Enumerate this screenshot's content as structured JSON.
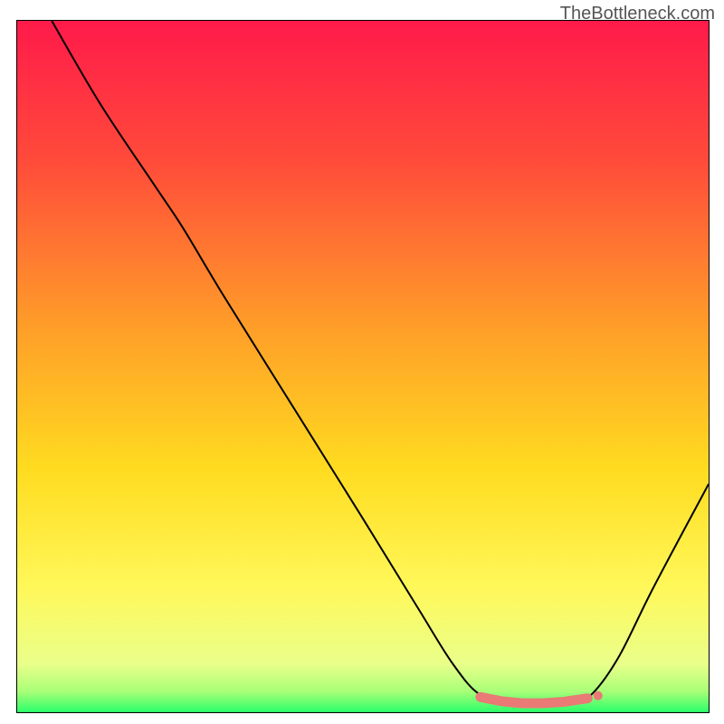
{
  "watermark": "TheBottleneck.com",
  "chart_data": {
    "type": "line",
    "title": "",
    "xlabel": "",
    "ylabel": "",
    "xlim": [
      0,
      100
    ],
    "ylim": [
      0,
      100
    ],
    "gradient_stops": [
      {
        "offset": 0,
        "color": "#ff1a4a"
      },
      {
        "offset": 20,
        "color": "#ff4a3a"
      },
      {
        "offset": 45,
        "color": "#ffa028"
      },
      {
        "offset": 65,
        "color": "#ffdc20"
      },
      {
        "offset": 82,
        "color": "#fff85a"
      },
      {
        "offset": 93,
        "color": "#eaff8a"
      },
      {
        "offset": 97,
        "color": "#a8ff78"
      },
      {
        "offset": 100,
        "color": "#2aff6a"
      }
    ],
    "series": [
      {
        "name": "bottleneck-curve",
        "color": "#000000",
        "points": [
          {
            "x": 5,
            "y": 100
          },
          {
            "x": 12,
            "y": 88
          },
          {
            "x": 20,
            "y": 76
          },
          {
            "x": 24,
            "y": 70
          },
          {
            "x": 30,
            "y": 60
          },
          {
            "x": 40,
            "y": 44
          },
          {
            "x": 50,
            "y": 28
          },
          {
            "x": 58,
            "y": 15
          },
          {
            "x": 63,
            "y": 7
          },
          {
            "x": 67,
            "y": 2.5
          },
          {
            "x": 72,
            "y": 1.2
          },
          {
            "x": 76,
            "y": 1.0
          },
          {
            "x": 80,
            "y": 1.2
          },
          {
            "x": 83,
            "y": 2.5
          },
          {
            "x": 87,
            "y": 8
          },
          {
            "x": 92,
            "y": 18
          },
          {
            "x": 100,
            "y": 33
          }
        ]
      },
      {
        "name": "marker-band",
        "color": "#e97a75",
        "points": [
          {
            "x": 67,
            "y": 2.2
          },
          {
            "x": 70,
            "y": 1.6
          },
          {
            "x": 73,
            "y": 1.3
          },
          {
            "x": 76,
            "y": 1.3
          },
          {
            "x": 79,
            "y": 1.5
          },
          {
            "x": 81,
            "y": 1.8
          },
          {
            "x": 82.5,
            "y": 2.0
          }
        ]
      }
    ]
  }
}
